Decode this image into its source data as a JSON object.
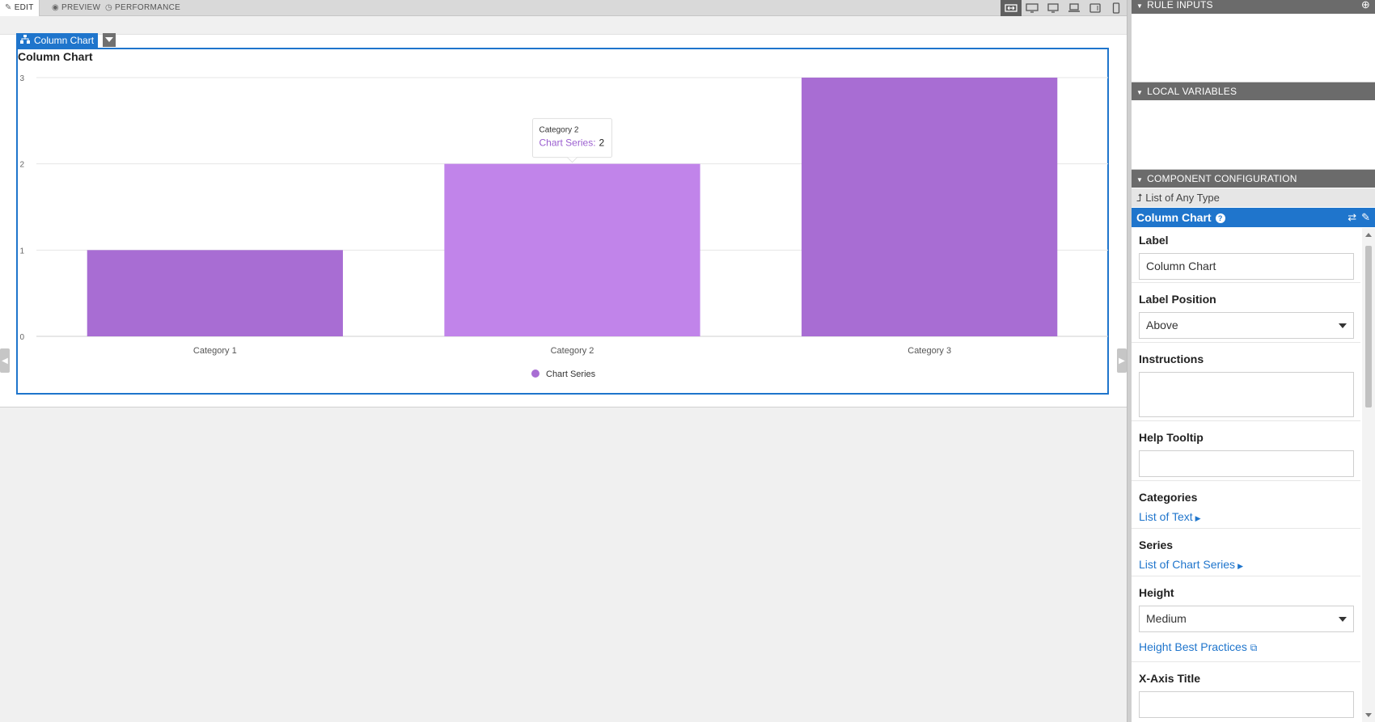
{
  "designer": {
    "tabs": [
      {
        "label": "EDIT",
        "icon": "pencil-icon"
      },
      {
        "label": "PREVIEW",
        "icon": "eye-icon"
      },
      {
        "label": "PERFORMANCE",
        "icon": "clock-icon"
      }
    ],
    "viewport_icons": [
      "fit-width-icon",
      "desktop-wide-icon",
      "desktop-icon",
      "laptop-icon",
      "tablet-icon",
      "phone-icon"
    ]
  },
  "component_tag": {
    "label": "Column Chart",
    "icon": "hierarchy-icon"
  },
  "chart_data": {
    "type": "bar",
    "title": "Column Chart",
    "categories": [
      "Category 1",
      "Category 2",
      "Category 3"
    ],
    "series": [
      {
        "name": "Chart Series",
        "values": [
          1,
          2,
          3
        ],
        "color": "#a86dd3"
      }
    ],
    "highlight_color": "#c184ea",
    "highlight_index": 1,
    "ylim": [
      0,
      3
    ],
    "yticks": [
      0,
      1,
      2,
      3
    ],
    "grid": true,
    "legend": "bottom-center",
    "tooltip": {
      "category": "Category 2",
      "series": "Chart Series",
      "value": "2"
    }
  },
  "panel": {
    "rule_inputs": "RULE INPUTS",
    "local_variables": "LOCAL VARIABLES",
    "component_configuration": "COMPONENT CONFIGURATION",
    "breadcrumb": "List of Any Type",
    "component_title": "Column Chart",
    "props": {
      "label": {
        "title": "Label",
        "value": "Column Chart"
      },
      "label_position": {
        "title": "Label Position",
        "value": "Above"
      },
      "instructions": {
        "title": "Instructions",
        "value": ""
      },
      "help_tooltip": {
        "title": "Help Tooltip",
        "value": ""
      },
      "categories": {
        "title": "Categories",
        "link": "List of Text"
      },
      "series": {
        "title": "Series",
        "link": "List of Chart Series"
      },
      "height": {
        "title": "Height",
        "value": "Medium",
        "link": "Height Best Practices"
      },
      "x_axis_title": {
        "title": "X-Axis Title",
        "value": ""
      }
    }
  }
}
